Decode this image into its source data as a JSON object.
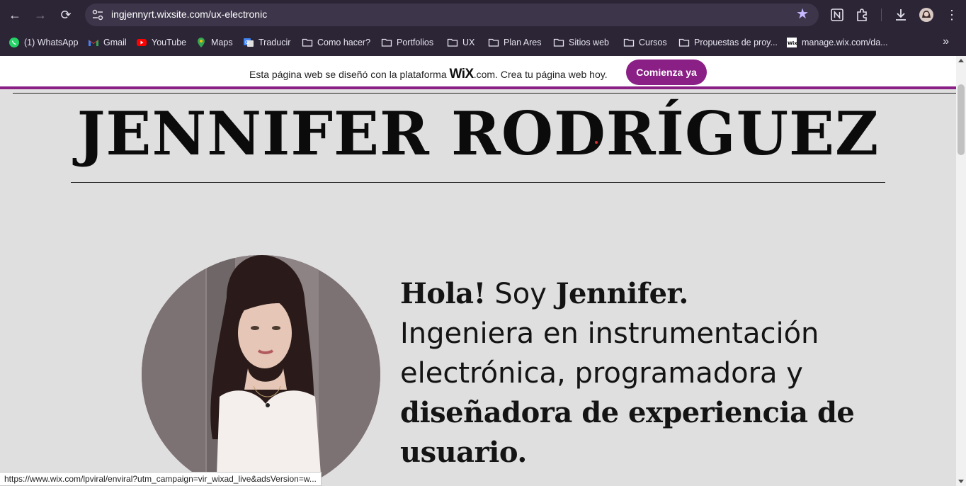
{
  "browser": {
    "url": "ingjennyrt.wixsite.com/ux-electronic",
    "bookmarks": [
      {
        "label": "(1) WhatsApp",
        "icon": "whatsapp-icon"
      },
      {
        "label": "Gmail",
        "icon": "gmail-icon"
      },
      {
        "label": "YouTube",
        "icon": "youtube-icon"
      },
      {
        "label": "Maps",
        "icon": "maps-icon"
      },
      {
        "label": "Traducir",
        "icon": "translate-icon"
      },
      {
        "label": "Como hacer?",
        "icon": "folder-icon"
      },
      {
        "label": "Portfolios",
        "icon": "folder-icon"
      },
      {
        "label": "UX",
        "icon": "folder-icon"
      },
      {
        "label": "Plan Ares",
        "icon": "folder-icon"
      },
      {
        "label": "Sitios web",
        "icon": "folder-icon"
      },
      {
        "label": "Cursos",
        "icon": "folder-icon"
      },
      {
        "label": "Propuestas de proy...",
        "icon": "folder-icon"
      },
      {
        "label": "manage.wix.com/da...",
        "icon": "wix-icon"
      }
    ]
  },
  "wix_banner": {
    "text_before": "Esta página web se diseñó con la plataforma ",
    "logo": "WiX",
    "text_after": ".com. Crea tu página web hoy.",
    "button_label": "Comienza ya"
  },
  "site": {
    "name": "JENNIFER RODRÍGUEZ",
    "intro": {
      "greeting": "Hola!",
      "soy": " Soy ",
      "first_name": "Jennifer.",
      "line2": "Ingeniera en instrumentación",
      "line3": "electrónica, programadora y",
      "line4": "diseñadora de experiencia de",
      "line5": "usuario."
    }
  },
  "status_url": "https://www.wix.com/lpviral/enviral?utm_campaign=vir_wixad_live&adsVersion=w...",
  "colors": {
    "accent": "#8a1f86",
    "page_bg": "#e0dfdf",
    "chrome_bg": "#2b2536",
    "star": "#c7b9ff"
  }
}
